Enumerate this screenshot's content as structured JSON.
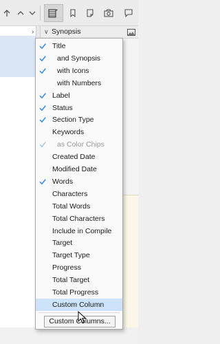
{
  "header": {
    "column_title": "Synopsis"
  },
  "toolbar": {
    "icons": [
      "up-arrow-icon",
      "chevron-up-icon",
      "chevron-down-icon",
      "columns-view-icon",
      "bookmark-icon",
      "note-icon",
      "snapshot-camera-icon",
      "comment-icon"
    ]
  },
  "menu": {
    "items": [
      {
        "label": "Title",
        "checked": true,
        "indent": false,
        "enabled": true
      },
      {
        "label": "and Synopsis",
        "checked": true,
        "indent": true,
        "enabled": true
      },
      {
        "label": "with Icons",
        "checked": true,
        "indent": true,
        "enabled": true
      },
      {
        "label": "with Numbers",
        "checked": false,
        "indent": true,
        "enabled": true
      },
      {
        "label": "Label",
        "checked": true,
        "indent": false,
        "enabled": true
      },
      {
        "label": "Status",
        "checked": true,
        "indent": false,
        "enabled": true
      },
      {
        "label": "Section Type",
        "checked": true,
        "indent": false,
        "enabled": true
      },
      {
        "label": "Keywords",
        "checked": false,
        "indent": false,
        "enabled": true
      },
      {
        "label": "as Color Chips",
        "checked": true,
        "indent": true,
        "enabled": false
      },
      {
        "label": "Created Date",
        "checked": false,
        "indent": false,
        "enabled": true
      },
      {
        "label": "Modified Date",
        "checked": false,
        "indent": false,
        "enabled": true
      },
      {
        "label": "Words",
        "checked": true,
        "indent": false,
        "enabled": true
      },
      {
        "label": "Characters",
        "checked": false,
        "indent": false,
        "enabled": true
      },
      {
        "label": "Total Words",
        "checked": false,
        "indent": false,
        "enabled": true
      },
      {
        "label": "Total Characters",
        "checked": false,
        "indent": false,
        "enabled": true
      },
      {
        "label": "Include in Compile",
        "checked": false,
        "indent": false,
        "enabled": true
      },
      {
        "label": "Target",
        "checked": false,
        "indent": false,
        "enabled": true
      },
      {
        "label": "Target Type",
        "checked": false,
        "indent": false,
        "enabled": true
      },
      {
        "label": "Progress",
        "checked": false,
        "indent": false,
        "enabled": true
      },
      {
        "label": "Total Target",
        "checked": false,
        "indent": false,
        "enabled": true
      },
      {
        "label": "Total Progress",
        "checked": false,
        "indent": false,
        "enabled": true
      },
      {
        "label": "Custom Column",
        "checked": false,
        "indent": false,
        "enabled": true,
        "highlighted": true
      }
    ],
    "button_label": "Custom Columns..."
  },
  "colors": {
    "check": "#3b8fe6",
    "check_disabled": "#a9c9ee",
    "highlight": "#cde3f9",
    "selection": "#dbe7f5"
  }
}
